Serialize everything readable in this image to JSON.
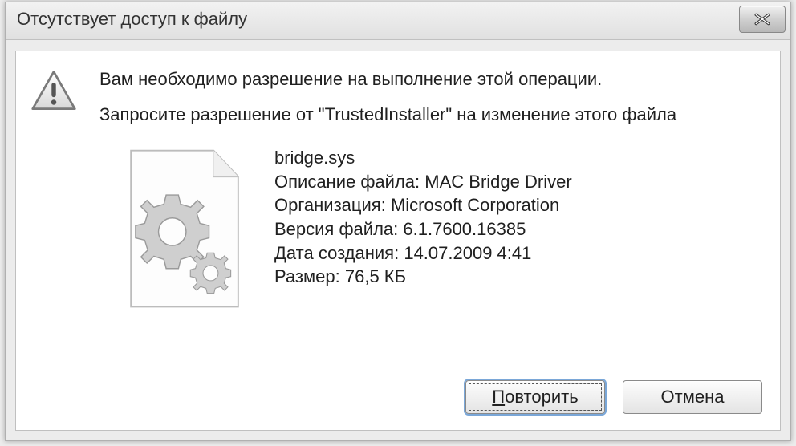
{
  "window": {
    "title": "Отсутствует доступ к файлу"
  },
  "icons": {
    "warning": "warning-triangle-icon",
    "file": "sys-file-gears-icon",
    "close": "close-icon"
  },
  "messages": {
    "line1": "Вам необходимо разрешение на выполнение этой операции.",
    "line2": "Запросите разрешение от \"TrustedInstaller\" на изменение этого файла"
  },
  "file": {
    "name": "bridge.sys",
    "description_label": "Описание файла:",
    "description_value": "MAC Bridge Driver",
    "org_label": "Организация:",
    "org_value": "Microsoft Corporation",
    "version_label": "Версия файла:",
    "version_value": "6.1.7600.16385",
    "created_label": "Дата создания:",
    "created_value": "14.07.2009 4:41",
    "size_label": "Размер:",
    "size_value": "76,5 КБ"
  },
  "buttons": {
    "retry": "Повторить",
    "cancel": "Отмена"
  }
}
